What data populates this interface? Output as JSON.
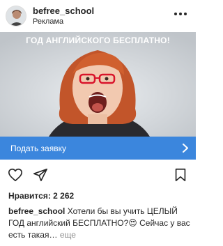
{
  "header": {
    "username": "befree_school",
    "sponsored": "Реклама",
    "more_icon": "more-horizontal-icon"
  },
  "ad": {
    "headline": "ГОД АНГЛИЙСКОГО БЕСПЛАТНО!",
    "background": "#d9dcdf"
  },
  "cta": {
    "label": "Подать заявку",
    "color": "#3b86dd",
    "icon": "chevron-right-icon"
  },
  "actions": {
    "like_icon": "heart-icon",
    "share_icon": "paper-plane-icon",
    "save_icon": "bookmark-icon"
  },
  "likes": {
    "text": "Нравится: 2 262"
  },
  "caption": {
    "username": "befree_school",
    "text": "Хотели бы вы учить ЦЕЛЫЙ ГОД английский БЕСПЛАТНО?😍 Сейчас у вас есть такая…",
    "more": "еще"
  }
}
